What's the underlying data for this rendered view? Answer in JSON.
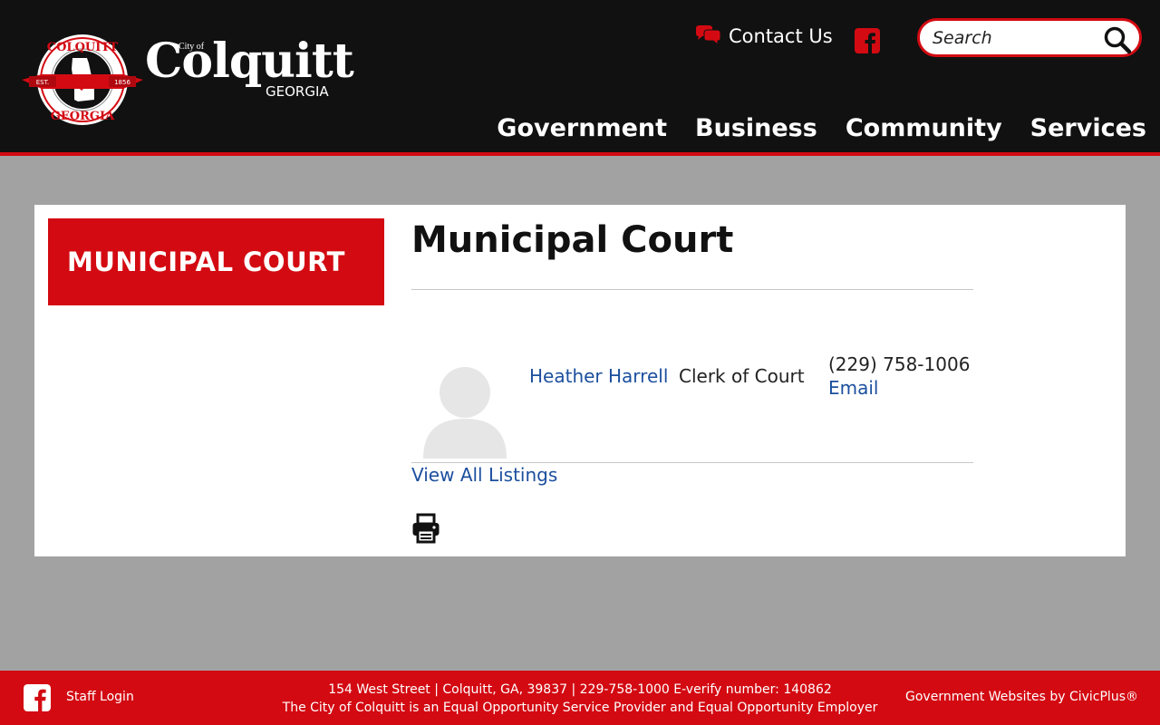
{
  "header": {
    "seal": {
      "top_text": "COLQUITT",
      "bottom_text": "GEORGIA",
      "ribbon_left": "EST.",
      "ribbon_right": "1856"
    },
    "brand": {
      "city_of": "City of",
      "name": "Colquitt",
      "state": "GEORGIA"
    },
    "contact_label": "Contact Us",
    "search_placeholder": "Search",
    "nav": [
      {
        "label": "Government"
      },
      {
        "label": "Business"
      },
      {
        "label": "Community"
      },
      {
        "label": "Services"
      }
    ]
  },
  "sidebar": {
    "heading": "MUNICIPAL COURT"
  },
  "main": {
    "title": "Municipal Court",
    "staff": {
      "name": "Heather Harrell",
      "title": "Clerk of Court",
      "phone": "(229) 758-1006",
      "email_label": "Email"
    },
    "view_all_label": "View All Listings"
  },
  "footer": {
    "staff_login": "Staff Login",
    "address_line": "154 West Street | Colquitt, GA, 39837 | 229-758-1000 E-verify number: 140862",
    "eo_line": "The City of Colquitt is an Equal Opportunity Service Provider and Equal Opportunity Employer",
    "credit": "Government Websites by CivicPlus®"
  },
  "icons": {
    "contact": "chat-bubbles-icon",
    "facebook": "facebook-icon",
    "search": "search-icon",
    "print": "print-icon",
    "avatar": "avatar-placeholder-icon"
  },
  "colors": {
    "header_bg": "#111111",
    "accent_red": "#d30a12",
    "page_bg": "#a2a2a2",
    "link_blue": "#1c4f9e"
  }
}
